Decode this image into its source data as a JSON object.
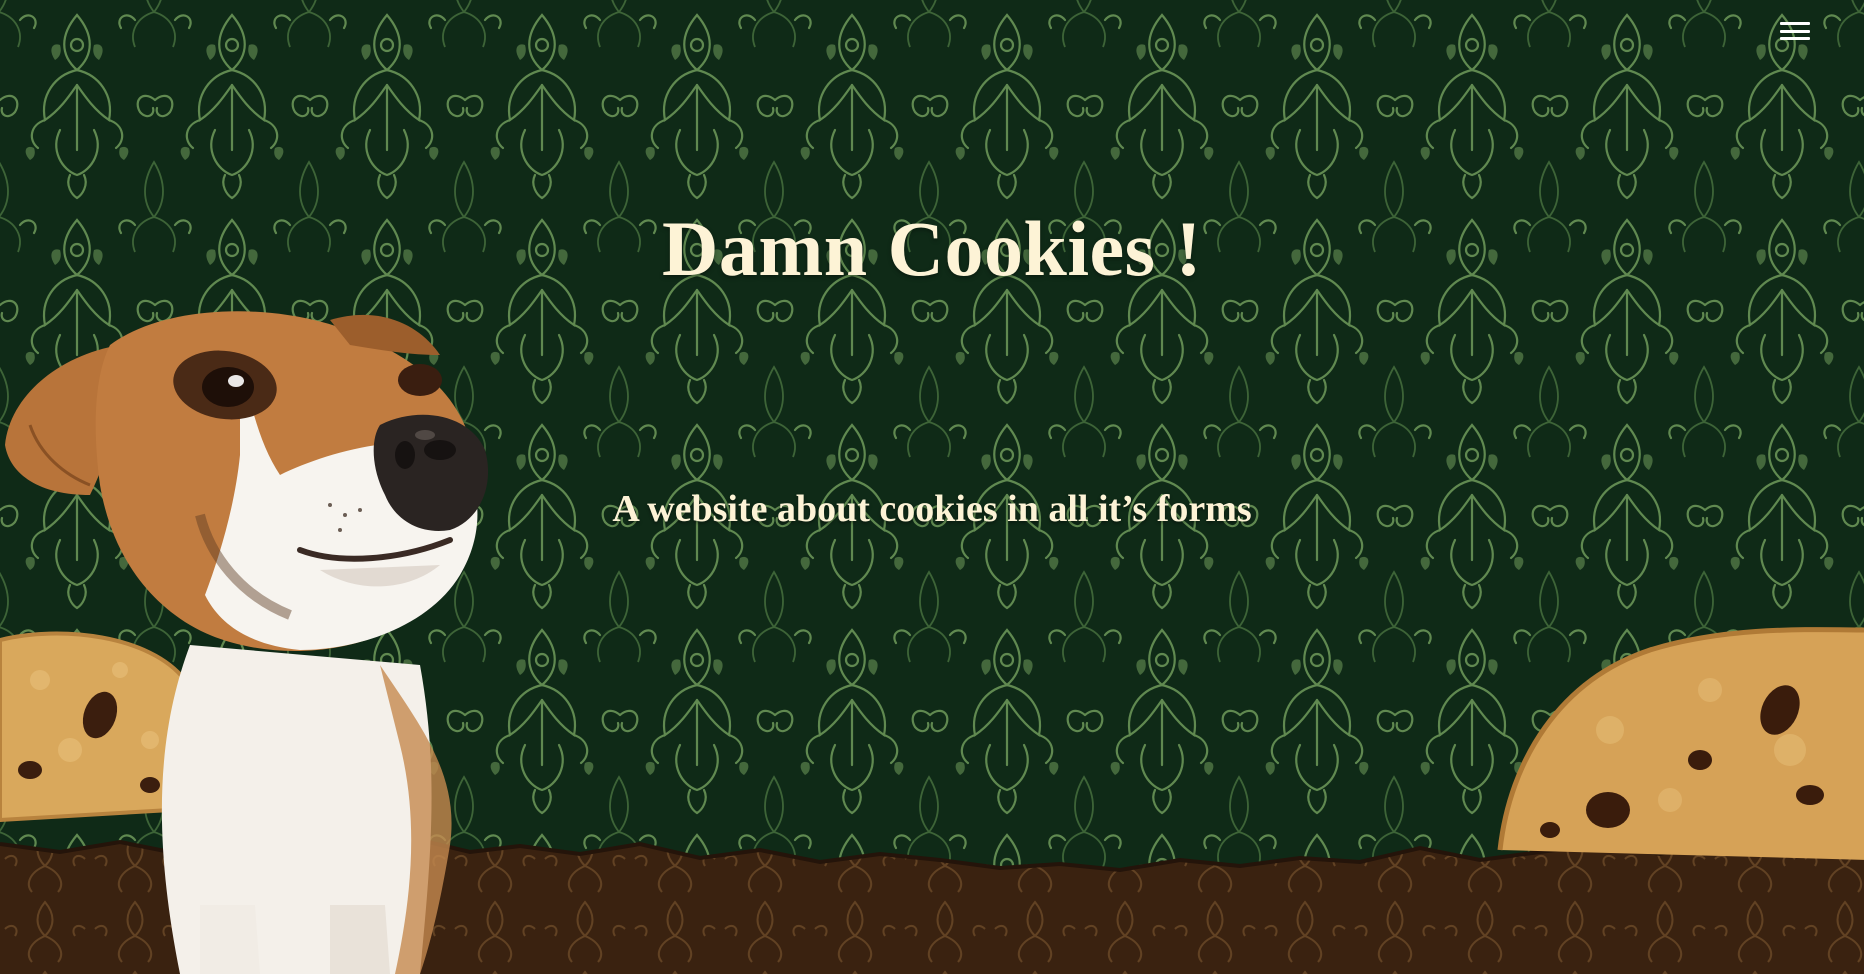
{
  "hero": {
    "title": "Damn Cookies !",
    "subtitle": "A website about cookies in all it’s forms"
  },
  "nav": {
    "menu_icon": "hamburger-menu-icon"
  },
  "images": {
    "mascot": "jack-russell-terrier-dog",
    "cookie_left": "chocolate-chip-cookie",
    "cookie_right": "chocolate-chip-cookie"
  },
  "colors": {
    "background": "#0f2a17",
    "damask_pattern": "#6e9a5a",
    "title_text": "#fdf3d6",
    "ground": "#3a2210",
    "menu_icon": "#ffffff"
  }
}
